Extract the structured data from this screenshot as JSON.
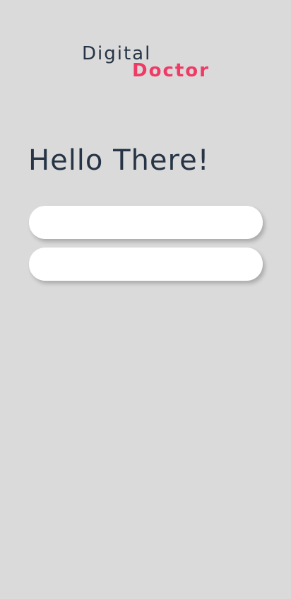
{
  "logo": {
    "line1": "Digital",
    "line2": "Doctor"
  },
  "greeting": "Hello There!",
  "fields": [
    {
      "value": "",
      "placeholder": ""
    },
    {
      "value": "",
      "placeholder": ""
    }
  ],
  "colors": {
    "background": "#dadada",
    "text_dark": "#263445",
    "accent": "#f03a66",
    "field": "#ffffff"
  }
}
